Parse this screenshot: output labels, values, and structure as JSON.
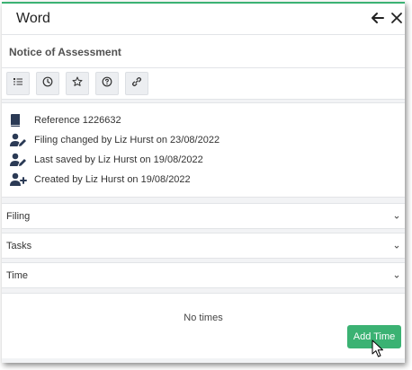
{
  "window": {
    "title": "Word",
    "back_icon": "arrow-left-icon",
    "close_icon": "close-icon",
    "accent_color": "#3bb273"
  },
  "document": {
    "subject": "Notice of Assessment"
  },
  "toolbar": {
    "buttons": [
      {
        "icon": "list-icon"
      },
      {
        "icon": "clock-icon"
      },
      {
        "icon": "star-icon"
      },
      {
        "icon": "help-circle-icon"
      },
      {
        "icon": "link-icon"
      }
    ]
  },
  "info": {
    "items": [
      {
        "icon": "book-icon",
        "text": "Reference 1226632"
      },
      {
        "icon": "user-edit-icon",
        "text": "Filing changed by Liz Hurst on 23/08/2022"
      },
      {
        "icon": "user-edit-icon",
        "text": "Last saved by Liz Hurst on 19/08/2022"
      },
      {
        "icon": "user-plus-icon",
        "text": "Created by Liz Hurst on 19/08/2022"
      }
    ]
  },
  "sections": [
    {
      "label": "Filing",
      "icon": "chevron-down-icon"
    },
    {
      "label": "Tasks",
      "icon": "chevron-down-icon"
    },
    {
      "label": "Time",
      "icon": "chevron-down-icon"
    }
  ],
  "time": {
    "empty_text": "No times",
    "add_button": "Add Time"
  }
}
